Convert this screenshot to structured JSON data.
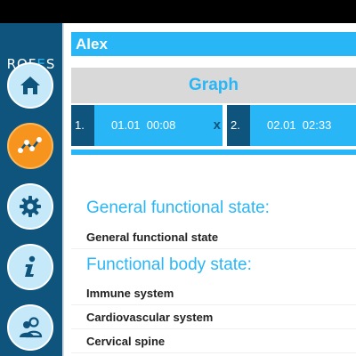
{
  "brand": {
    "logo_pre": "ROF",
    "logo_accent": "E",
    "logo_post": "S"
  },
  "nav": [
    {
      "icon": "home-icon",
      "active": false
    },
    {
      "icon": "graph-icon",
      "active": true
    },
    {
      "icon": "gear-icon",
      "active": false
    },
    {
      "icon": "info-icon",
      "active": false
    },
    {
      "icon": "users-icon",
      "active": false
    }
  ],
  "patient": {
    "name": "Alex"
  },
  "graph": {
    "label": "Graph"
  },
  "records": [
    {
      "num": "1.",
      "date": "01.01",
      "time": "00:08",
      "remove": "x"
    },
    {
      "num": "2.",
      "date": "02.01",
      "time": "02:33"
    }
  ],
  "sections": [
    {
      "title": "General functional state:",
      "items": [
        "General functional state"
      ]
    },
    {
      "title": "Functional body state:",
      "items": [
        "Immune system",
        "Cardiovascular system",
        "Cervical spine"
      ]
    }
  ],
  "colors": {
    "accent": "#29b6f6",
    "sidebar": "#0e547c",
    "active": "#f7941d",
    "navbtn": "#c5e9f8"
  }
}
